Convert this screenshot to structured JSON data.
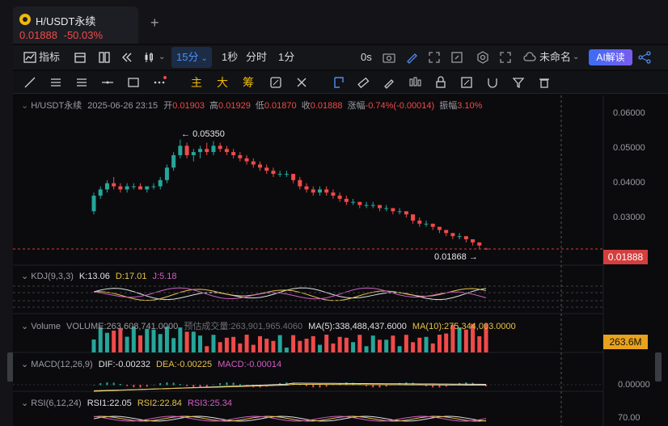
{
  "tab": {
    "title": "H/USDT永续",
    "price": "0.01888",
    "change": "-50.03%",
    "new_tab": "+"
  },
  "toolbar": {
    "indicators": "指标",
    "intervals": [
      "15分",
      "1秒",
      "分时",
      "1分"
    ],
    "active_interval": "15分",
    "countdown": "0s",
    "layout_name": "未命名",
    "ai_button": "AI解读"
  },
  "drawbar": {
    "main": "主",
    "big": "大",
    "chip": "筹"
  },
  "info": {
    "symbol": "H/USDT永续",
    "datetime": "2025-06-26 23:15",
    "open_label": "开",
    "open": "0.01903",
    "high_label": "高",
    "high": "0.01929",
    "low_label": "低",
    "low": "0.01870",
    "close_label": "收",
    "close": "0.01888",
    "chg_label": "涨幅",
    "chg": "-0.74%(-0.00014)",
    "amp_label": "振幅",
    "amp": "3.10%"
  },
  "price_axis": {
    "ticks": [
      "0.06000",
      "0.05000",
      "0.04000",
      "0.03000"
    ],
    "last_price": "0.01888",
    "high_annot": "0.05350",
    "low_annot": "0.01868"
  },
  "kdj": {
    "name": "KDJ(9,3,3)",
    "k": "K:13.06",
    "d": "D:17.01",
    "j": "J:5.18"
  },
  "volume": {
    "name": "Volume",
    "value": "VOLUME:263,608,741.0000",
    "forecast": "预估成交量:263,901,965.4060",
    "ma5": "MA(5):338,488,437.6000",
    "ma10": "MA(10):275,344,003.0000",
    "tag": "263.6M"
  },
  "macd": {
    "name": "MACD(12,26,9)",
    "dif": "DIF:-0.00232",
    "dea": "DEA:-0.00225",
    "macd": "MACD:-0.00014",
    "zero": "0.00000"
  },
  "rsi": {
    "name": "RSI(6,12,24)",
    "rsi1": "RSI1:22.05",
    "rsi2": "RSI2:22.84",
    "rsi3": "RSI3:25.34",
    "tick": "70.00"
  },
  "colors": {
    "up": "#26a69a",
    "down": "#f04a4a",
    "accent": "#4e8ef7",
    "yellow": "#e5c34a",
    "pink": "#d35ec6"
  },
  "chart_data": {
    "type": "candlestick",
    "ylim": [
      0.015,
      0.063
    ],
    "candles": [
      [
        0.031,
        0.037,
        0.03,
        0.036
      ],
      [
        0.036,
        0.039,
        0.035,
        0.038
      ],
      [
        0.038,
        0.041,
        0.037,
        0.04
      ],
      [
        0.04,
        0.042,
        0.038,
        0.039
      ],
      [
        0.039,
        0.04,
        0.037,
        0.038
      ],
      [
        0.038,
        0.04,
        0.037,
        0.039
      ],
      [
        0.039,
        0.04,
        0.038,
        0.039
      ],
      [
        0.039,
        0.04,
        0.038,
        0.038
      ],
      [
        0.038,
        0.039,
        0.037,
        0.039
      ],
      [
        0.039,
        0.04,
        0.038,
        0.039
      ],
      [
        0.039,
        0.042,
        0.038,
        0.041
      ],
      [
        0.041,
        0.046,
        0.04,
        0.045
      ],
      [
        0.045,
        0.05,
        0.044,
        0.049
      ],
      [
        0.049,
        0.054,
        0.048,
        0.052
      ],
      [
        0.052,
        0.053,
        0.048,
        0.049
      ],
      [
        0.049,
        0.051,
        0.047,
        0.05
      ],
      [
        0.05,
        0.052,
        0.048,
        0.051
      ],
      [
        0.051,
        0.053,
        0.049,
        0.05
      ],
      [
        0.05,
        0.0535,
        0.049,
        0.052
      ],
      [
        0.052,
        0.053,
        0.05,
        0.051
      ],
      [
        0.051,
        0.052,
        0.049,
        0.05
      ],
      [
        0.05,
        0.051,
        0.048,
        0.049
      ],
      [
        0.049,
        0.05,
        0.047,
        0.048
      ],
      [
        0.048,
        0.049,
        0.046,
        0.047
      ],
      [
        0.047,
        0.048,
        0.045,
        0.046
      ],
      [
        0.046,
        0.047,
        0.044,
        0.045
      ],
      [
        0.045,
        0.046,
        0.043,
        0.044
      ],
      [
        0.044,
        0.045,
        0.042,
        0.043
      ],
      [
        0.043,
        0.044,
        0.042,
        0.043
      ],
      [
        0.043,
        0.044,
        0.042,
        0.043
      ],
      [
        0.043,
        0.043,
        0.04,
        0.041
      ],
      [
        0.041,
        0.042,
        0.038,
        0.039
      ],
      [
        0.039,
        0.04,
        0.037,
        0.038
      ],
      [
        0.038,
        0.039,
        0.036,
        0.037
      ],
      [
        0.037,
        0.039,
        0.036,
        0.038
      ],
      [
        0.038,
        0.039,
        0.036,
        0.037
      ],
      [
        0.037,
        0.038,
        0.035,
        0.036
      ],
      [
        0.036,
        0.037,
        0.034,
        0.035
      ],
      [
        0.035,
        0.036,
        0.033,
        0.034
      ],
      [
        0.034,
        0.035,
        0.033,
        0.034
      ],
      [
        0.034,
        0.034,
        0.032,
        0.033
      ],
      [
        0.033,
        0.034,
        0.032,
        0.033
      ],
      [
        0.033,
        0.034,
        0.032,
        0.033
      ],
      [
        0.033,
        0.033,
        0.031,
        0.032
      ],
      [
        0.032,
        0.033,
        0.031,
        0.032
      ],
      [
        0.032,
        0.032,
        0.03,
        0.031
      ],
      [
        0.031,
        0.032,
        0.03,
        0.031
      ],
      [
        0.031,
        0.031,
        0.029,
        0.03
      ],
      [
        0.03,
        0.03,
        0.027,
        0.028
      ],
      [
        0.028,
        0.029,
        0.026,
        0.027
      ],
      [
        0.027,
        0.028,
        0.026,
        0.027
      ],
      [
        0.027,
        0.027,
        0.025,
        0.026
      ],
      [
        0.026,
        0.026,
        0.024,
        0.025
      ],
      [
        0.025,
        0.025,
        0.023,
        0.024
      ],
      [
        0.024,
        0.024,
        0.022,
        0.023
      ],
      [
        0.023,
        0.024,
        0.022,
        0.023
      ],
      [
        0.023,
        0.023,
        0.021,
        0.022
      ],
      [
        0.022,
        0.022,
        0.02,
        0.021
      ],
      [
        0.021,
        0.021,
        0.019,
        0.02
      ],
      [
        0.019,
        0.0193,
        0.0187,
        0.0189
      ]
    ]
  }
}
